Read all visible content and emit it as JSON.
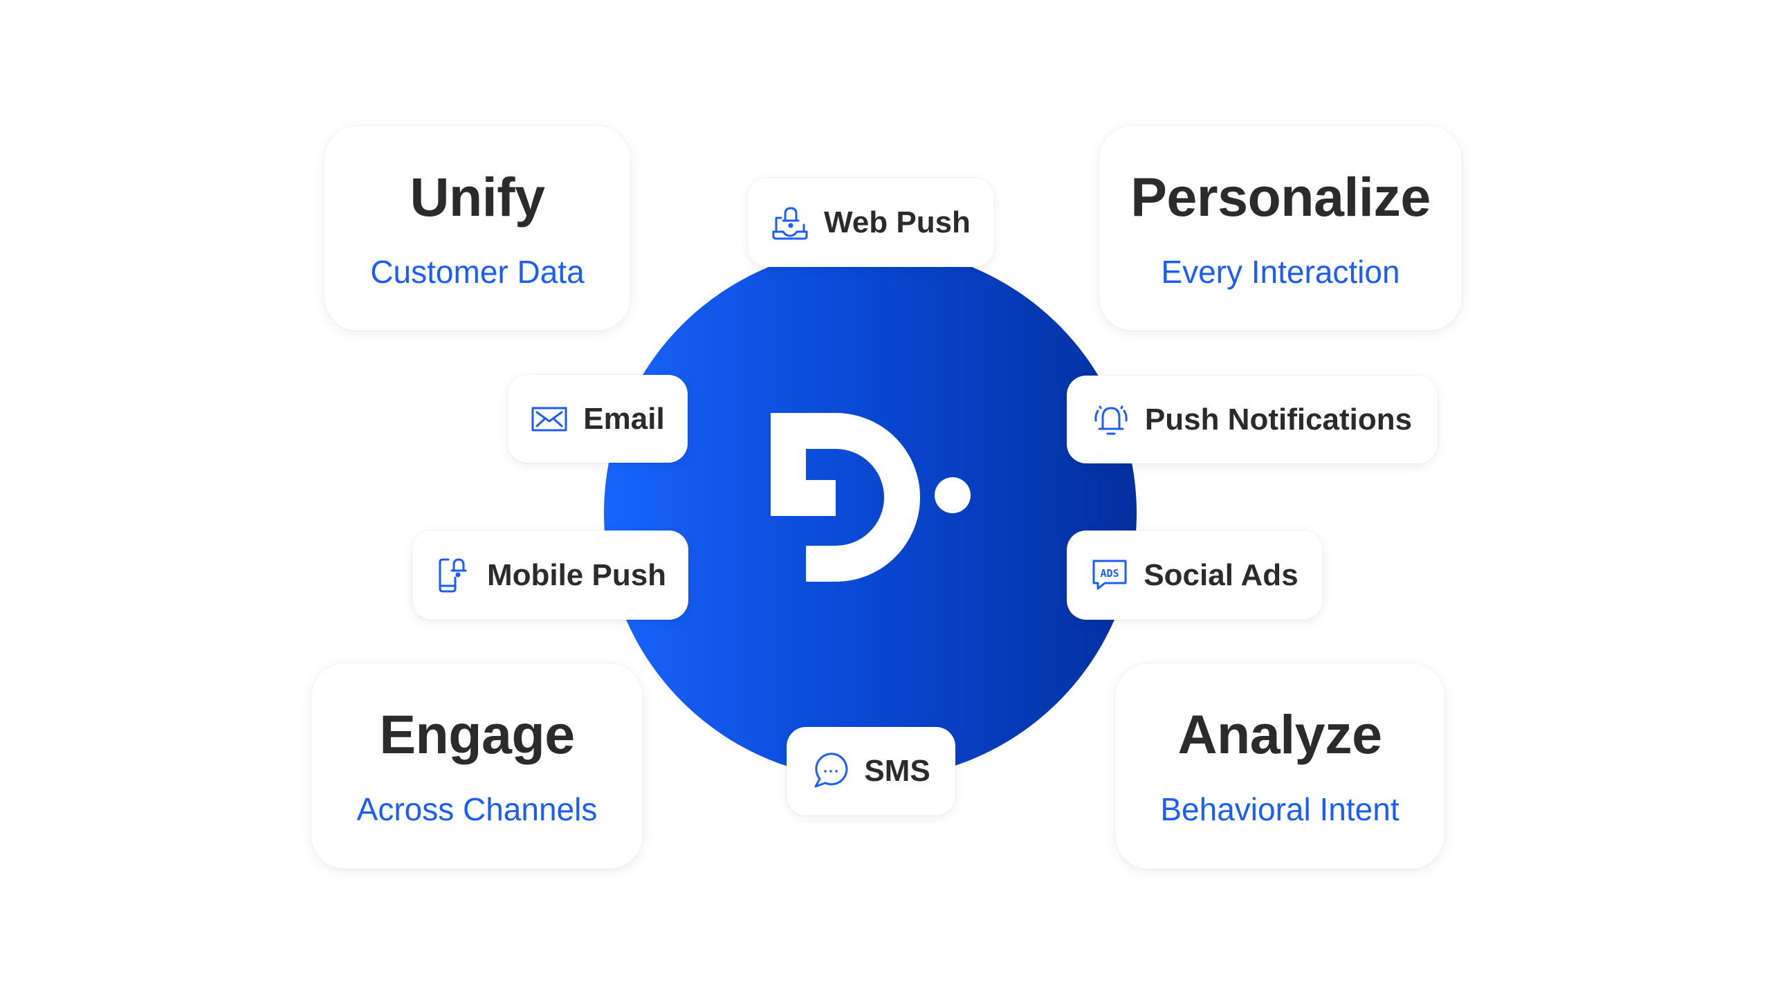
{
  "colors": {
    "accent": "#1a5ef7",
    "heading": "#2b2b2b",
    "hub_gradient_start": "#1865fa",
    "hub_gradient_end": "#03309f",
    "logo": "#ffffff"
  },
  "hub": {
    "logo_icon": "brand-d-logo-icon"
  },
  "pillars": {
    "unify": {
      "title": "Unify",
      "subtitle": "Customer Data"
    },
    "personalize": {
      "title": "Personalize",
      "subtitle": "Every Interaction"
    },
    "engage": {
      "title": "Engage",
      "subtitle": "Across Channels"
    },
    "analyze": {
      "title": "Analyze",
      "subtitle": "Behavioral Intent"
    }
  },
  "channels": {
    "web_push": {
      "label": "Web Push",
      "icon": "laptop-bell-icon"
    },
    "email": {
      "label": "Email",
      "icon": "envelope-icon"
    },
    "mobile_push": {
      "label": "Mobile Push",
      "icon": "phone-bell-icon"
    },
    "push_notifications": {
      "label": "Push Notifications",
      "icon": "ringing-bell-icon"
    },
    "social_ads": {
      "label": "Social Ads",
      "icon": "ads-chat-icon",
      "icon_text": "ADS"
    },
    "sms": {
      "label": "SMS",
      "icon": "chat-bubble-dots-icon"
    }
  }
}
